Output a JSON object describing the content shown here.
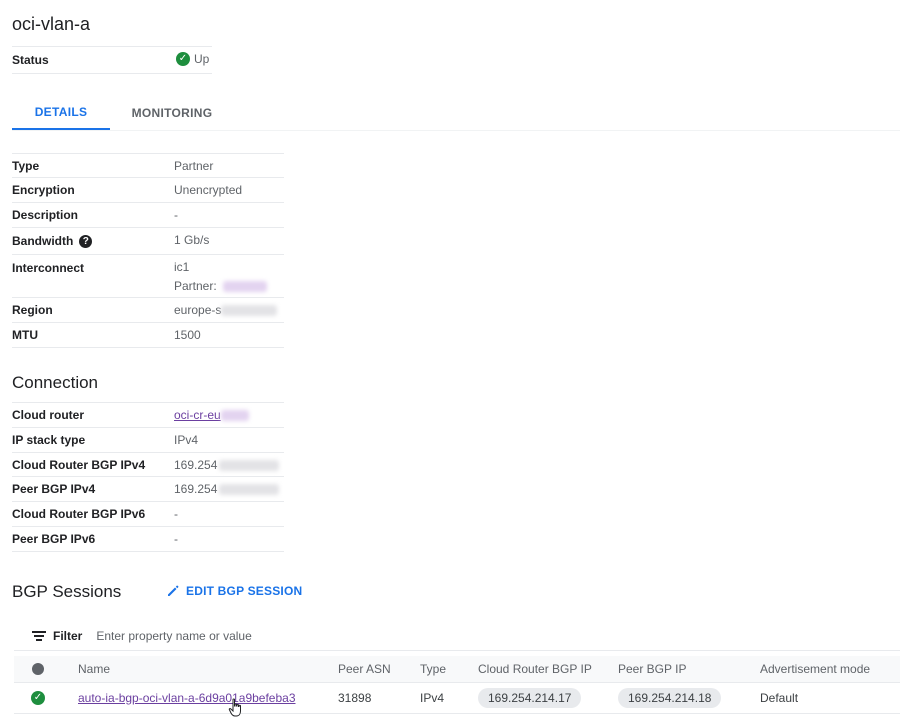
{
  "page": {
    "title": "oci-vlan-a"
  },
  "status": {
    "label": "Status",
    "value": "Up"
  },
  "tabs": [
    {
      "label": "DETAILS",
      "active": true
    },
    {
      "label": "MONITORING",
      "active": false
    }
  ],
  "details": {
    "type": {
      "label": "Type",
      "value": "Partner"
    },
    "encryption": {
      "label": "Encryption",
      "value": "Unencrypted"
    },
    "description": {
      "label": "Description",
      "value": "-"
    },
    "bandwidth": {
      "label": "Bandwidth",
      "value": "1 Gb/s"
    },
    "interconnect": {
      "label": "Interconnect",
      "value": "ic1",
      "partner_label": "Partner:"
    },
    "region": {
      "label": "Region",
      "value": "europe-s"
    },
    "mtu": {
      "label": "MTU",
      "value": "1500"
    }
  },
  "connection": {
    "heading": "Connection",
    "cloud_router": {
      "label": "Cloud router",
      "value": "oci-cr-eu"
    },
    "ip_stack_type": {
      "label": "IP stack type",
      "value": "IPv4"
    },
    "cloud_router_bgp_ipv4": {
      "label": "Cloud Router BGP IPv4",
      "value": "169.254"
    },
    "peer_bgp_ipv4": {
      "label": "Peer BGP IPv4",
      "value": "169.254"
    },
    "cloud_router_bgp_ipv6": {
      "label": "Cloud Router BGP IPv6",
      "value": "-"
    },
    "peer_bgp_ipv6": {
      "label": "Peer BGP IPv6",
      "value": "-"
    }
  },
  "bgp": {
    "heading": "BGP Sessions",
    "edit_label": "EDIT BGP SESSION",
    "filter_label": "Filter",
    "filter_placeholder": "Enter property name or value",
    "columns": {
      "name": "Name",
      "peer_asn": "Peer ASN",
      "type": "Type",
      "cloud_router_bgp_ip": "Cloud Router BGP IP",
      "peer_bgp_ip": "Peer BGP IP",
      "advertisement_mode": "Advertisement mode"
    },
    "rows": [
      {
        "name": "auto-ia-bgp-oci-vlan-a-6d9a01a9befeba3",
        "peer_asn": "31898",
        "type": "IPv4",
        "cloud_router_bgp_ip": "169.254.214.17",
        "peer_bgp_ip": "169.254.214.18",
        "advertisement_mode": "Default"
      }
    ]
  },
  "colors": {
    "accent": "#1a73e8",
    "success": "#1e8e3e",
    "link": "#6b3fa0"
  },
  "icons": [
    "check-circle-icon",
    "help-icon",
    "pencil-icon",
    "filter-icon",
    "status-dot-icon",
    "hand-cursor-icon"
  ]
}
